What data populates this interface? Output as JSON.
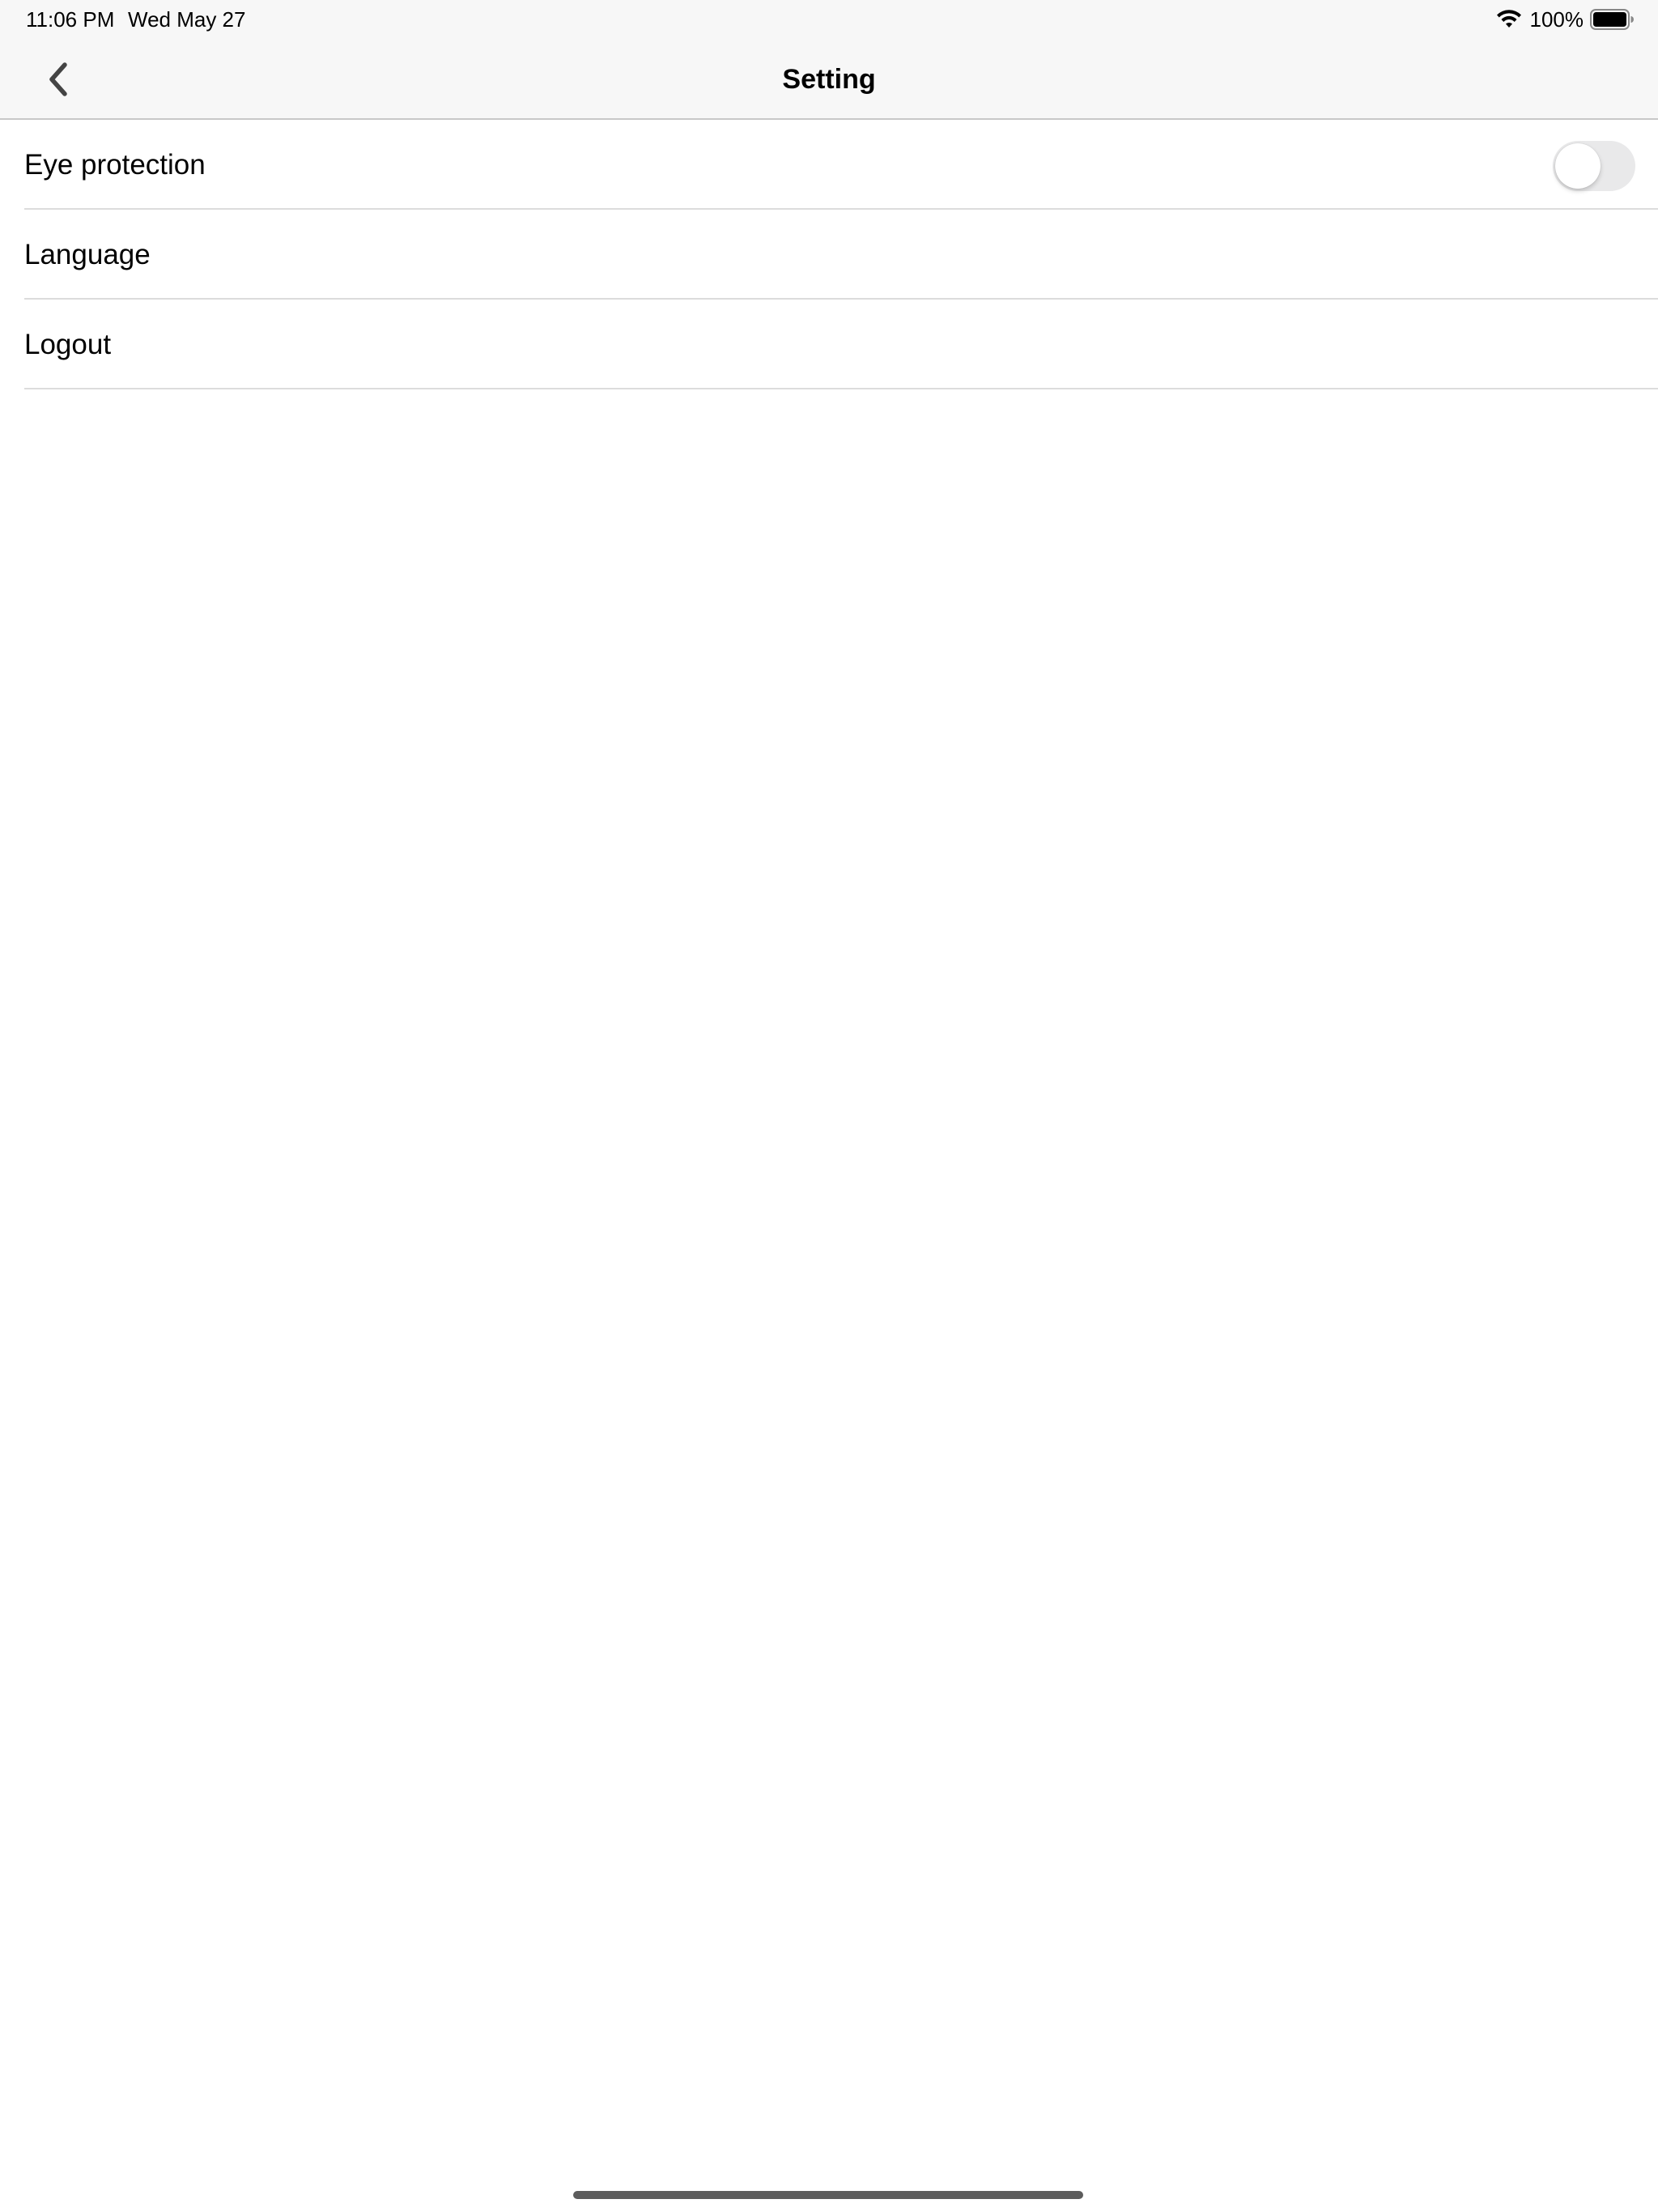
{
  "status_bar": {
    "time": "11:06 PM",
    "date": "Wed May 27",
    "battery_percent": "100%",
    "battery_level": 1.0,
    "wifi_icon": "wifi-icon",
    "battery_icon": "battery-icon"
  },
  "nav_bar": {
    "title": "Setting",
    "back_icon": "chevron-left-icon"
  },
  "settings": {
    "items": [
      {
        "label": "Eye protection",
        "control": "toggle",
        "toggle_on": false
      },
      {
        "label": "Language"
      },
      {
        "label": "Logout"
      }
    ]
  },
  "colors": {
    "nav_background": "#f7f7f7",
    "toggle_off_track": "#e9e9ea",
    "separator": "#dcdcdc"
  }
}
